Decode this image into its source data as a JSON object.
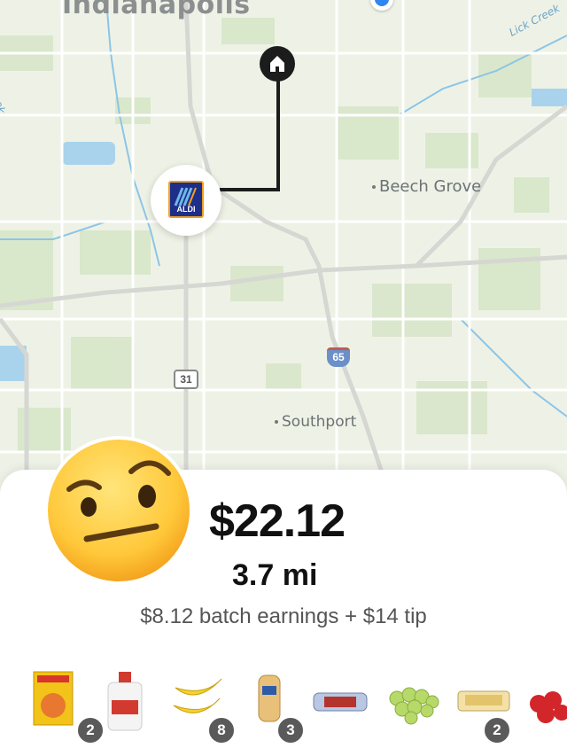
{
  "map": {
    "city_label": "Indianapolis",
    "labels": {
      "beech_grove": "Beech Grove",
      "southport": "Southport",
      "lick_creek": "Lick Creek",
      "creek": "Creek"
    },
    "highway_shields": {
      "interstate": "65",
      "us_route": "31"
    },
    "store_logo_text": "ALDI",
    "store_name": "ALDI"
  },
  "offer": {
    "price": "$22.12",
    "distance": "3.7 mi",
    "earnings_breakdown": "$8.12 batch earnings + $14 tip"
  },
  "items": [
    {
      "name": "boxed-meal-kit",
      "count": "2"
    },
    {
      "name": "milk-gallon",
      "count": ""
    },
    {
      "name": "bananas",
      "count": "8"
    },
    {
      "name": "sliced-bread",
      "count": "3"
    },
    {
      "name": "cookies-pack",
      "count": ""
    },
    {
      "name": "green-grapes",
      "count": ""
    },
    {
      "name": "snack-cakes",
      "count": "2"
    },
    {
      "name": "strawberries",
      "count": ""
    }
  ],
  "colors": {
    "route": "#1c1c1c",
    "panel": "#ffffff",
    "badge": "#5a5a5a",
    "map_bg": "#eef2e6"
  }
}
